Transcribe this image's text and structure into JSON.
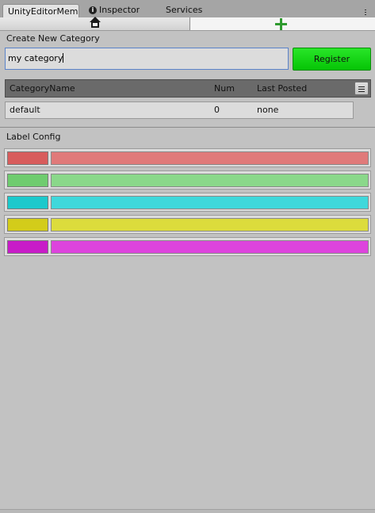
{
  "tabs": {
    "active": "UnityEditorMem",
    "inspector": "Inspector",
    "services": "Services"
  },
  "create": {
    "label": "Create New Category",
    "input_value": "my category",
    "register_label": "Register"
  },
  "table": {
    "headers": [
      "CategoryName",
      "Num",
      "Last Posted"
    ],
    "rows": [
      {
        "name": "default",
        "num": "0",
        "last": "none"
      }
    ]
  },
  "label_config": {
    "title": "Label Config",
    "labels": [
      {
        "swatch": "#d85c5c",
        "bar": "#e07a7a"
      },
      {
        "swatch": "#6fcc6f",
        "bar": "#8ad88a"
      },
      {
        "swatch": "#1cc9cc",
        "bar": "#3fd8db"
      },
      {
        "swatch": "#d3cc1a",
        "bar": "#dcdc3c"
      },
      {
        "swatch": "#c81cc8",
        "bar": "#dd44dd"
      }
    ]
  }
}
